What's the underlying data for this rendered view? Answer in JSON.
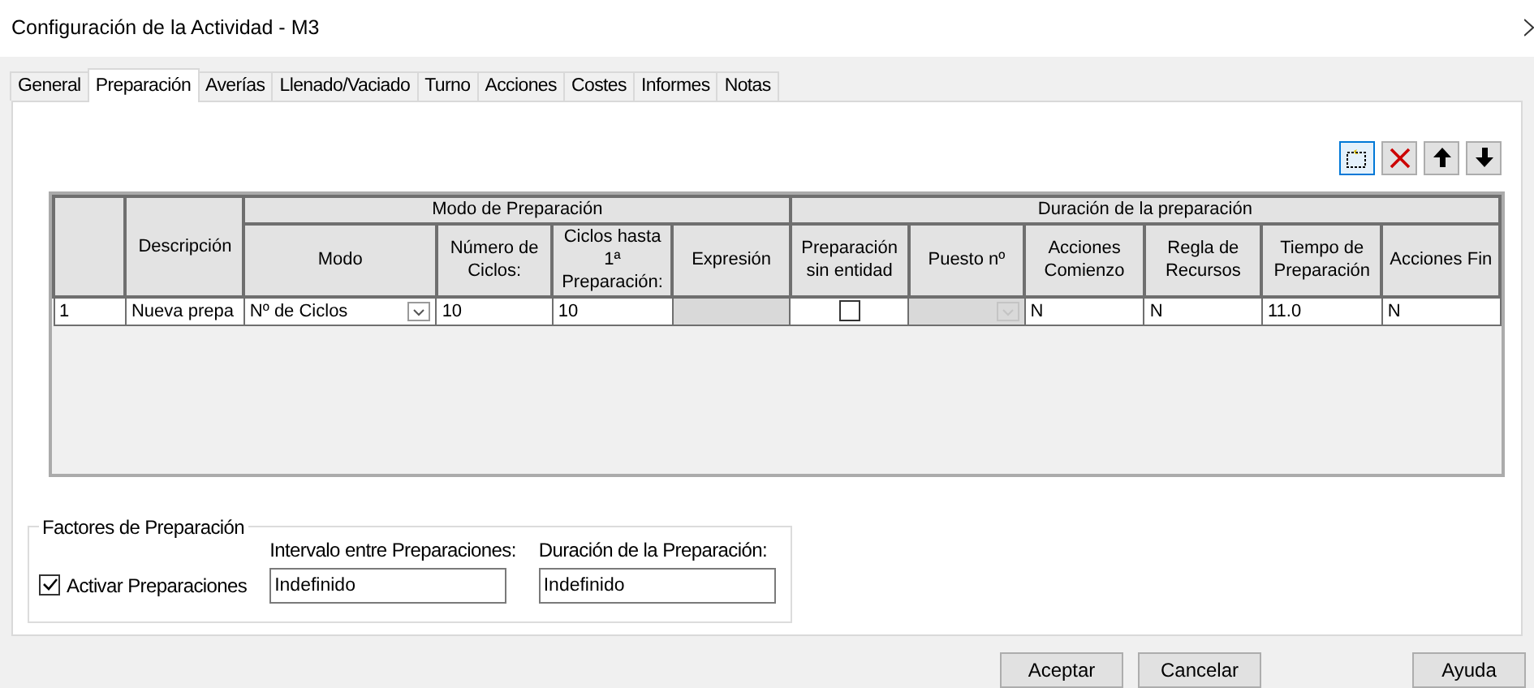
{
  "window": {
    "title": "Configuración de la Actividad - M3"
  },
  "tabs": [
    {
      "label": "General",
      "selected": false
    },
    {
      "label": "Preparación",
      "selected": true
    },
    {
      "label": "Averías",
      "selected": false
    },
    {
      "label": "Llenado/Vaciado",
      "selected": false
    },
    {
      "label": "Turno",
      "selected": false
    },
    {
      "label": "Acciones",
      "selected": false
    },
    {
      "label": "Costes",
      "selected": false
    },
    {
      "label": "Informes",
      "selected": false
    },
    {
      "label": "Notas",
      "selected": false
    }
  ],
  "toolbar": [
    {
      "kind": "new",
      "selected": true
    },
    {
      "kind": "delete",
      "selected": false
    },
    {
      "kind": "up",
      "selected": false
    },
    {
      "kind": "down",
      "selected": false
    }
  ],
  "table": {
    "groups": [
      {
        "label": "Modo de Preparación"
      },
      {
        "label": "Duración de la preparación"
      }
    ],
    "columns": [
      "Descripción",
      "Modo",
      "Número de Ciclos:",
      "Ciclos hasta 1ª Preparación:",
      "Expresión",
      "Preparación sin entidad",
      "Puesto nº",
      "Acciones Comienzo",
      "Regla de Recursos",
      "Tiempo de Preparación",
      "Acciones Fin"
    ],
    "rows": [
      {
        "number": "1",
        "cells": [
          {
            "kind": "text",
            "value": "Nueva prepa"
          },
          {
            "kind": "combo",
            "value": "Nº de Ciclos",
            "disabled": false
          },
          {
            "kind": "text",
            "value": "10"
          },
          {
            "kind": "text",
            "value": "10"
          },
          {
            "kind": "empty"
          },
          {
            "kind": "checkbox",
            "checked": false
          },
          {
            "kind": "combo",
            "disabled": true
          },
          {
            "kind": "text",
            "value": "N"
          },
          {
            "kind": "text",
            "value": "N"
          },
          {
            "kind": "text",
            "value": "11.0"
          },
          {
            "kind": "text",
            "value": "N"
          }
        ]
      }
    ]
  },
  "factors": {
    "title": "Factores de Preparación",
    "activate": {
      "label": "Activar Preparaciones",
      "checked": true
    },
    "fields": [
      {
        "label": "Intervalo entre Preparaciones:",
        "value": "Indefinido"
      },
      {
        "label": "Duración de la Preparación:",
        "value": "Indefinido"
      }
    ]
  },
  "buttons": [
    {
      "label": "Aceptar"
    },
    {
      "label": "Cancelar"
    },
    {
      "label": "Ayuda"
    }
  ]
}
